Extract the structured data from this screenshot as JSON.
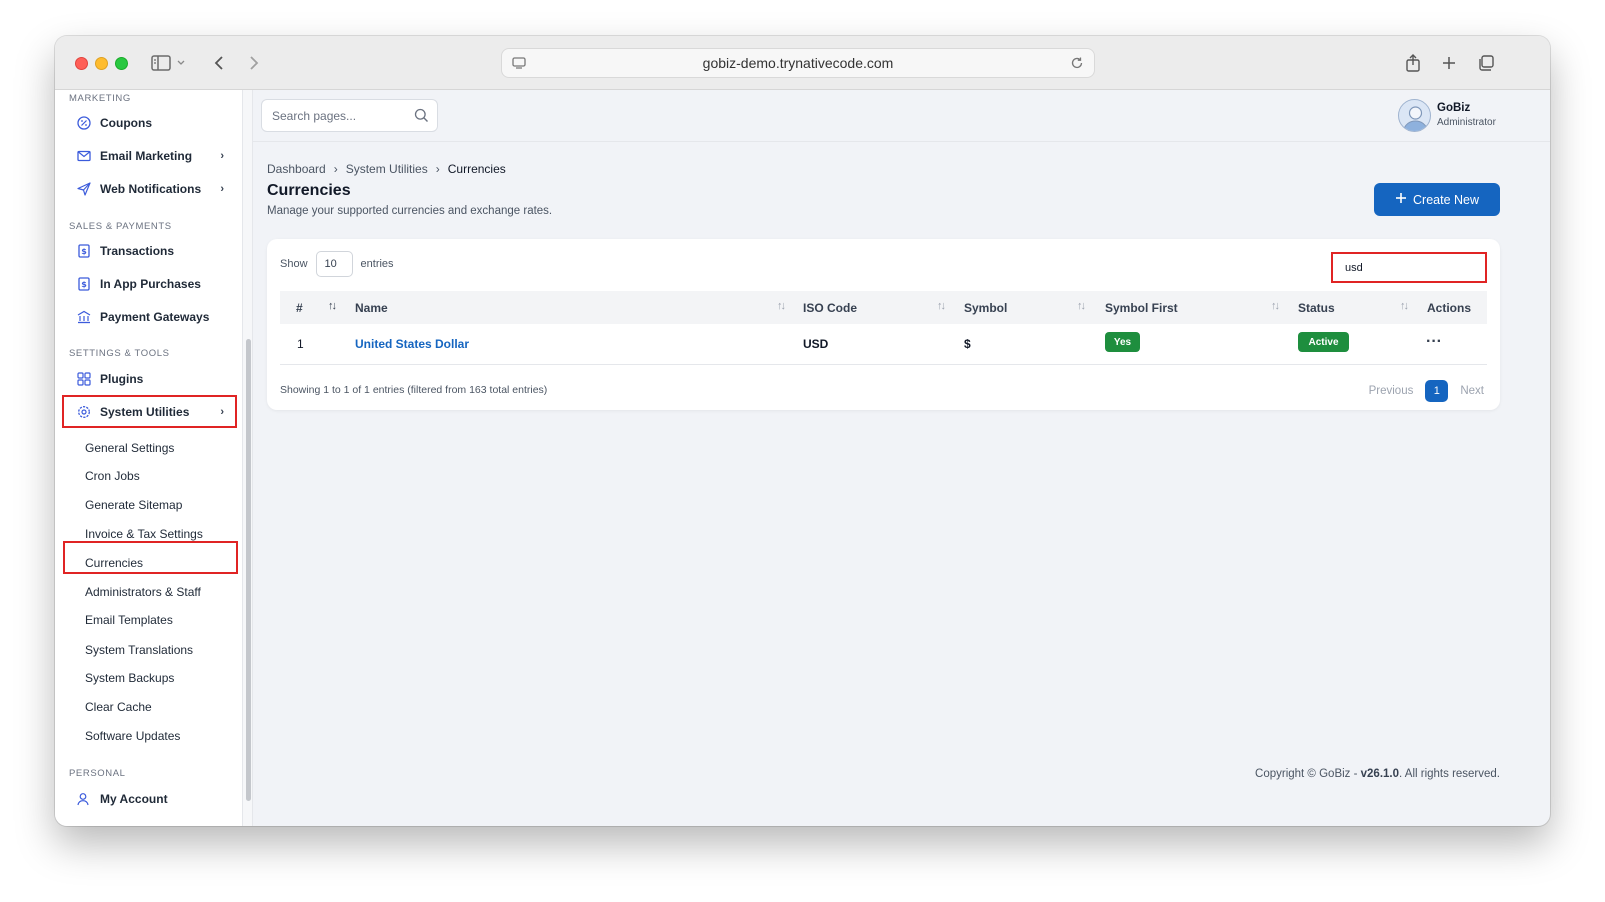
{
  "browser": {
    "url": "gobiz-demo.trynativecode.com"
  },
  "sidebar": {
    "sections": {
      "marketing": "MARKETING",
      "sales": "SALES & PAYMENTS",
      "settings": "SETTINGS & TOOLS",
      "personal": "PERSONAL"
    },
    "items": [
      {
        "label": "Coupons",
        "icon": "coupon-icon"
      },
      {
        "label": "Email Marketing",
        "icon": "mail-icon"
      },
      {
        "label": "Web Notifications",
        "icon": "send-icon"
      },
      {
        "label": "Transactions",
        "icon": "receipt-icon"
      },
      {
        "label": "In App Purchases",
        "icon": "receipt-icon"
      },
      {
        "label": "Payment Gateways",
        "icon": "bank-icon"
      },
      {
        "label": "Plugins",
        "icon": "plugins-icon"
      },
      {
        "label": "System Utilities",
        "icon": "gear-icon"
      },
      {
        "label": "My Account",
        "icon": "user-icon"
      }
    ],
    "sub_items": [
      "General Settings",
      "Cron Jobs",
      "Generate Sitemap",
      "Invoice & Tax Settings",
      "Currencies",
      "Administrators & Staff",
      "Email Templates",
      "System Translations",
      "System Backups",
      "Clear Cache",
      "Software Updates"
    ]
  },
  "topbar": {
    "search_placeholder": "Search pages...",
    "user_name": "GoBiz",
    "user_role": "Administrator"
  },
  "breadcrumb": [
    "Dashboard",
    "System Utilities",
    "Currencies"
  ],
  "page": {
    "title": "Currencies",
    "subtitle": "Manage your supported currencies and exchange rates.",
    "create_label": "Create New"
  },
  "table": {
    "show_label": "Show",
    "page_length": "10",
    "entries_label": "entries",
    "filter_value": "usd",
    "columns": [
      "#",
      "Name",
      "ISO Code",
      "Symbol",
      "Symbol First",
      "Status",
      "Actions"
    ],
    "rows": [
      {
        "index": "1",
        "name": "United States Dollar",
        "iso": "USD",
        "symbol": "$",
        "symbol_first": "Yes",
        "status": "Active",
        "actions": "···"
      }
    ],
    "info": "Showing 1 to 1 of 1 entries (filtered from 163 total entries)",
    "pager": {
      "previous": "Previous",
      "current": "1",
      "next": "Next"
    }
  },
  "footer": {
    "prefix": "Copyright © GoBiz - ",
    "version": "v26.1.0",
    "suffix": ". All rights reserved."
  },
  "colors": {
    "accent": "#1565c0",
    "success": "#1e8e3e",
    "highlight": "#e02424"
  }
}
